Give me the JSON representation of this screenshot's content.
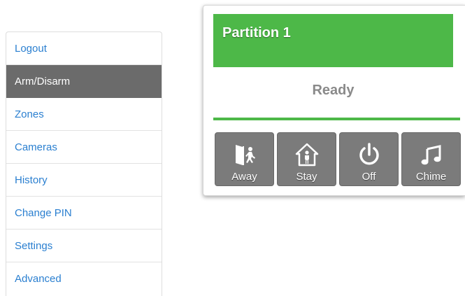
{
  "sidebar": {
    "items": [
      {
        "label": "Logout"
      },
      {
        "label": "Arm/Disarm"
      },
      {
        "label": "Zones"
      },
      {
        "label": "Cameras"
      },
      {
        "label": "History"
      },
      {
        "label": "Change PIN"
      },
      {
        "label": "Settings"
      },
      {
        "label": "Advanced"
      }
    ],
    "active_item": "Arm/Disarm"
  },
  "partition": {
    "title": "Partition 1",
    "status": "Ready",
    "buttons": [
      {
        "label": "Away",
        "icon": "away-icon"
      },
      {
        "label": "Stay",
        "icon": "stay-icon"
      },
      {
        "label": "Off",
        "icon": "power-icon"
      },
      {
        "label": "Chime",
        "icon": "chime-icon"
      }
    ]
  },
  "colors": {
    "ready_green": "#4db848",
    "link_blue": "#2a7fd0",
    "active_gray": "#6b6b6b",
    "button_gray": "#7b7b7b"
  }
}
